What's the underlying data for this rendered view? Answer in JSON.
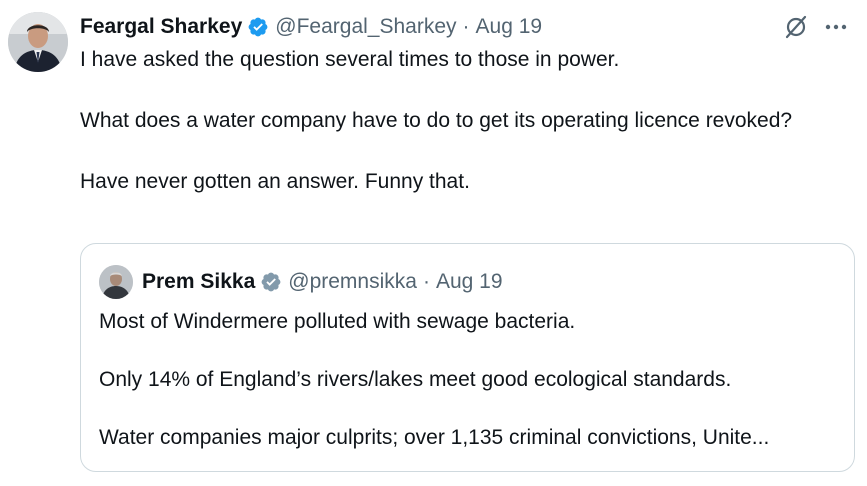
{
  "tweet": {
    "author": {
      "name": "Feargal Sharkey",
      "handle": "@Feargal_Sharkey",
      "verified": true
    },
    "separator": "·",
    "date": "Aug 19",
    "paragraphs": [
      "I have asked the question several times to those in power.",
      "What does a water company have to do to get its operating licence revoked?",
      "Have never gotten an answer. Funny that."
    ],
    "icons": {
      "grok": "grok-icon",
      "more": "more-options-icon",
      "verified": "verified-badge-icon"
    }
  },
  "quote": {
    "author": {
      "name": "Prem Sikka",
      "handle": "@premnsikka",
      "verified": true
    },
    "separator": "·",
    "date": "Aug 19",
    "paragraphs": [
      "Most of Windermere polluted with sewage bacteria.",
      "Only 14% of England’s rivers/lakes meet good ecological standards.",
      "Water companies major culprits; over 1,135 criminal convictions, Unite..."
    ]
  },
  "colors": {
    "text_primary": "#0f1419",
    "text_secondary": "#536471",
    "verified_blue": "#1d9bf0",
    "quote_verified_gray": "#829aab",
    "border": "#cfd9de"
  }
}
